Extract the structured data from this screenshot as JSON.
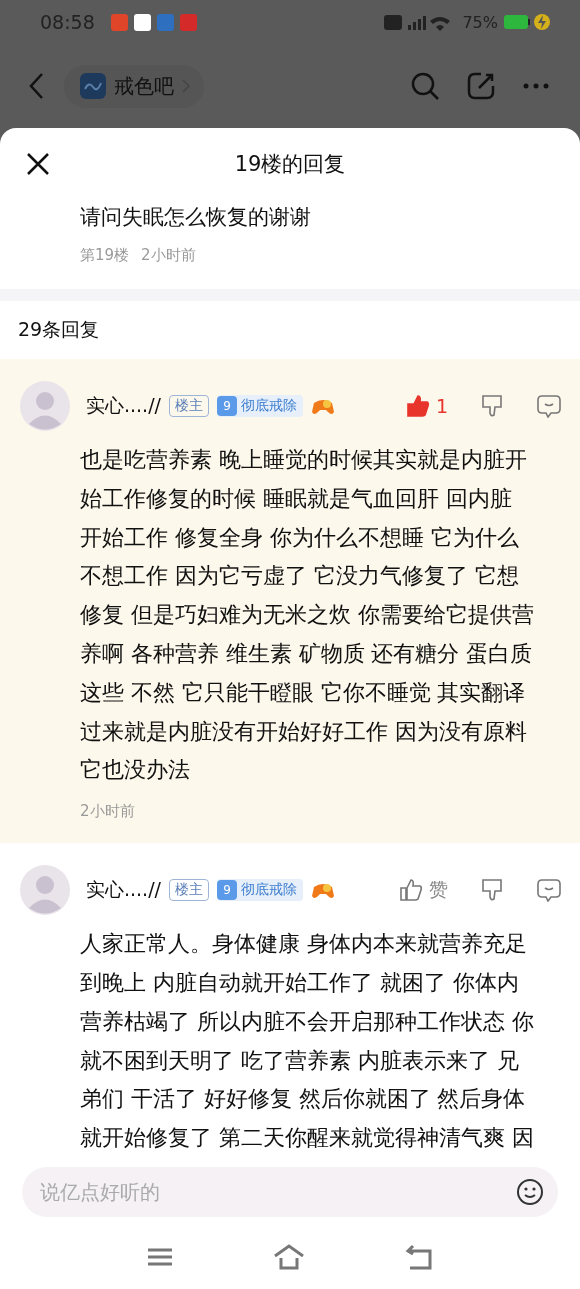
{
  "status_bar": {
    "time": "08:58",
    "battery": "75%"
  },
  "nav": {
    "forum": "戒色吧"
  },
  "sheet": {
    "title": "19楼的回复"
  },
  "quoted_post": {
    "text": "请问失眠怎么恢复的谢谢",
    "floor": "第19楼",
    "time": "2小时前"
  },
  "reply_count": "29条回复",
  "replies": [
    {
      "name": "实心....//",
      "op_badge": "楼主",
      "level": "9",
      "level_title": "彻底戒除",
      "liked": true,
      "like_text": "1",
      "highlighted": true,
      "text_lines": [
        "也是吃营养素 晚上睡觉的时候其实就是内脏开",
        "始工作修复的时候 睡眠就是气血回肝 回内脏",
        "开始工作 修复全身 你为什么不想睡 它为什么",
        "不想工作 因为它亏虚了 它没力气修复了 它想",
        "修复 但是巧妇难为无米之炊 你需要给它提供营",
        "养啊 各种营养 维生素 矿物质 还有糖分 蛋白质",
        "这些 不然 它只能干瞪眼 它你不睡觉 其实翻译",
        "过来就是内脏没有开始好好工作 因为没有原料",
        "它也没办法"
      ],
      "time": "2小时前"
    },
    {
      "name": "实心....//",
      "op_badge": "楼主",
      "level": "9",
      "level_title": "彻底戒除",
      "liked": false,
      "like_text": "赞",
      "highlighted": false,
      "text_lines": [
        "人家正常人。身体健康 身体内本来就营养充足",
        "到晚上 内脏自动就开始工作了 就困了 你体内",
        "营养枯竭了 所以内脏不会开启那种工作状态 你",
        "就不困到天明了 吃了营养素 内脏表示来了 兄",
        "弟们 干活了 好好修复 然后你就困了 然后身体",
        "就开始修复了 第二天你醒来就觉得神清气爽 因"
      ]
    }
  ],
  "comment_input": {
    "placeholder": "说亿点好听的"
  }
}
